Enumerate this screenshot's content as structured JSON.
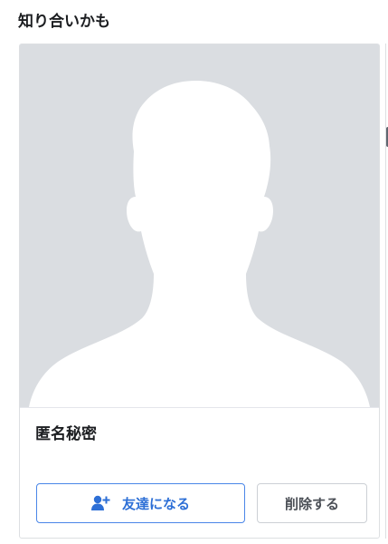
{
  "section": {
    "title": "知り合いかも"
  },
  "card": {
    "name": "匿名秘密",
    "avatar_icon": "person-silhouette-icon",
    "add_friend": {
      "label": "友達になる",
      "icon": "add-friend-icon"
    },
    "delete": {
      "label": "削除する"
    }
  },
  "colors": {
    "accent": "#2d6fd6",
    "button_border": "#4a86e8",
    "photo_bg": "#dadde1",
    "card_border": "#dddfe2"
  }
}
